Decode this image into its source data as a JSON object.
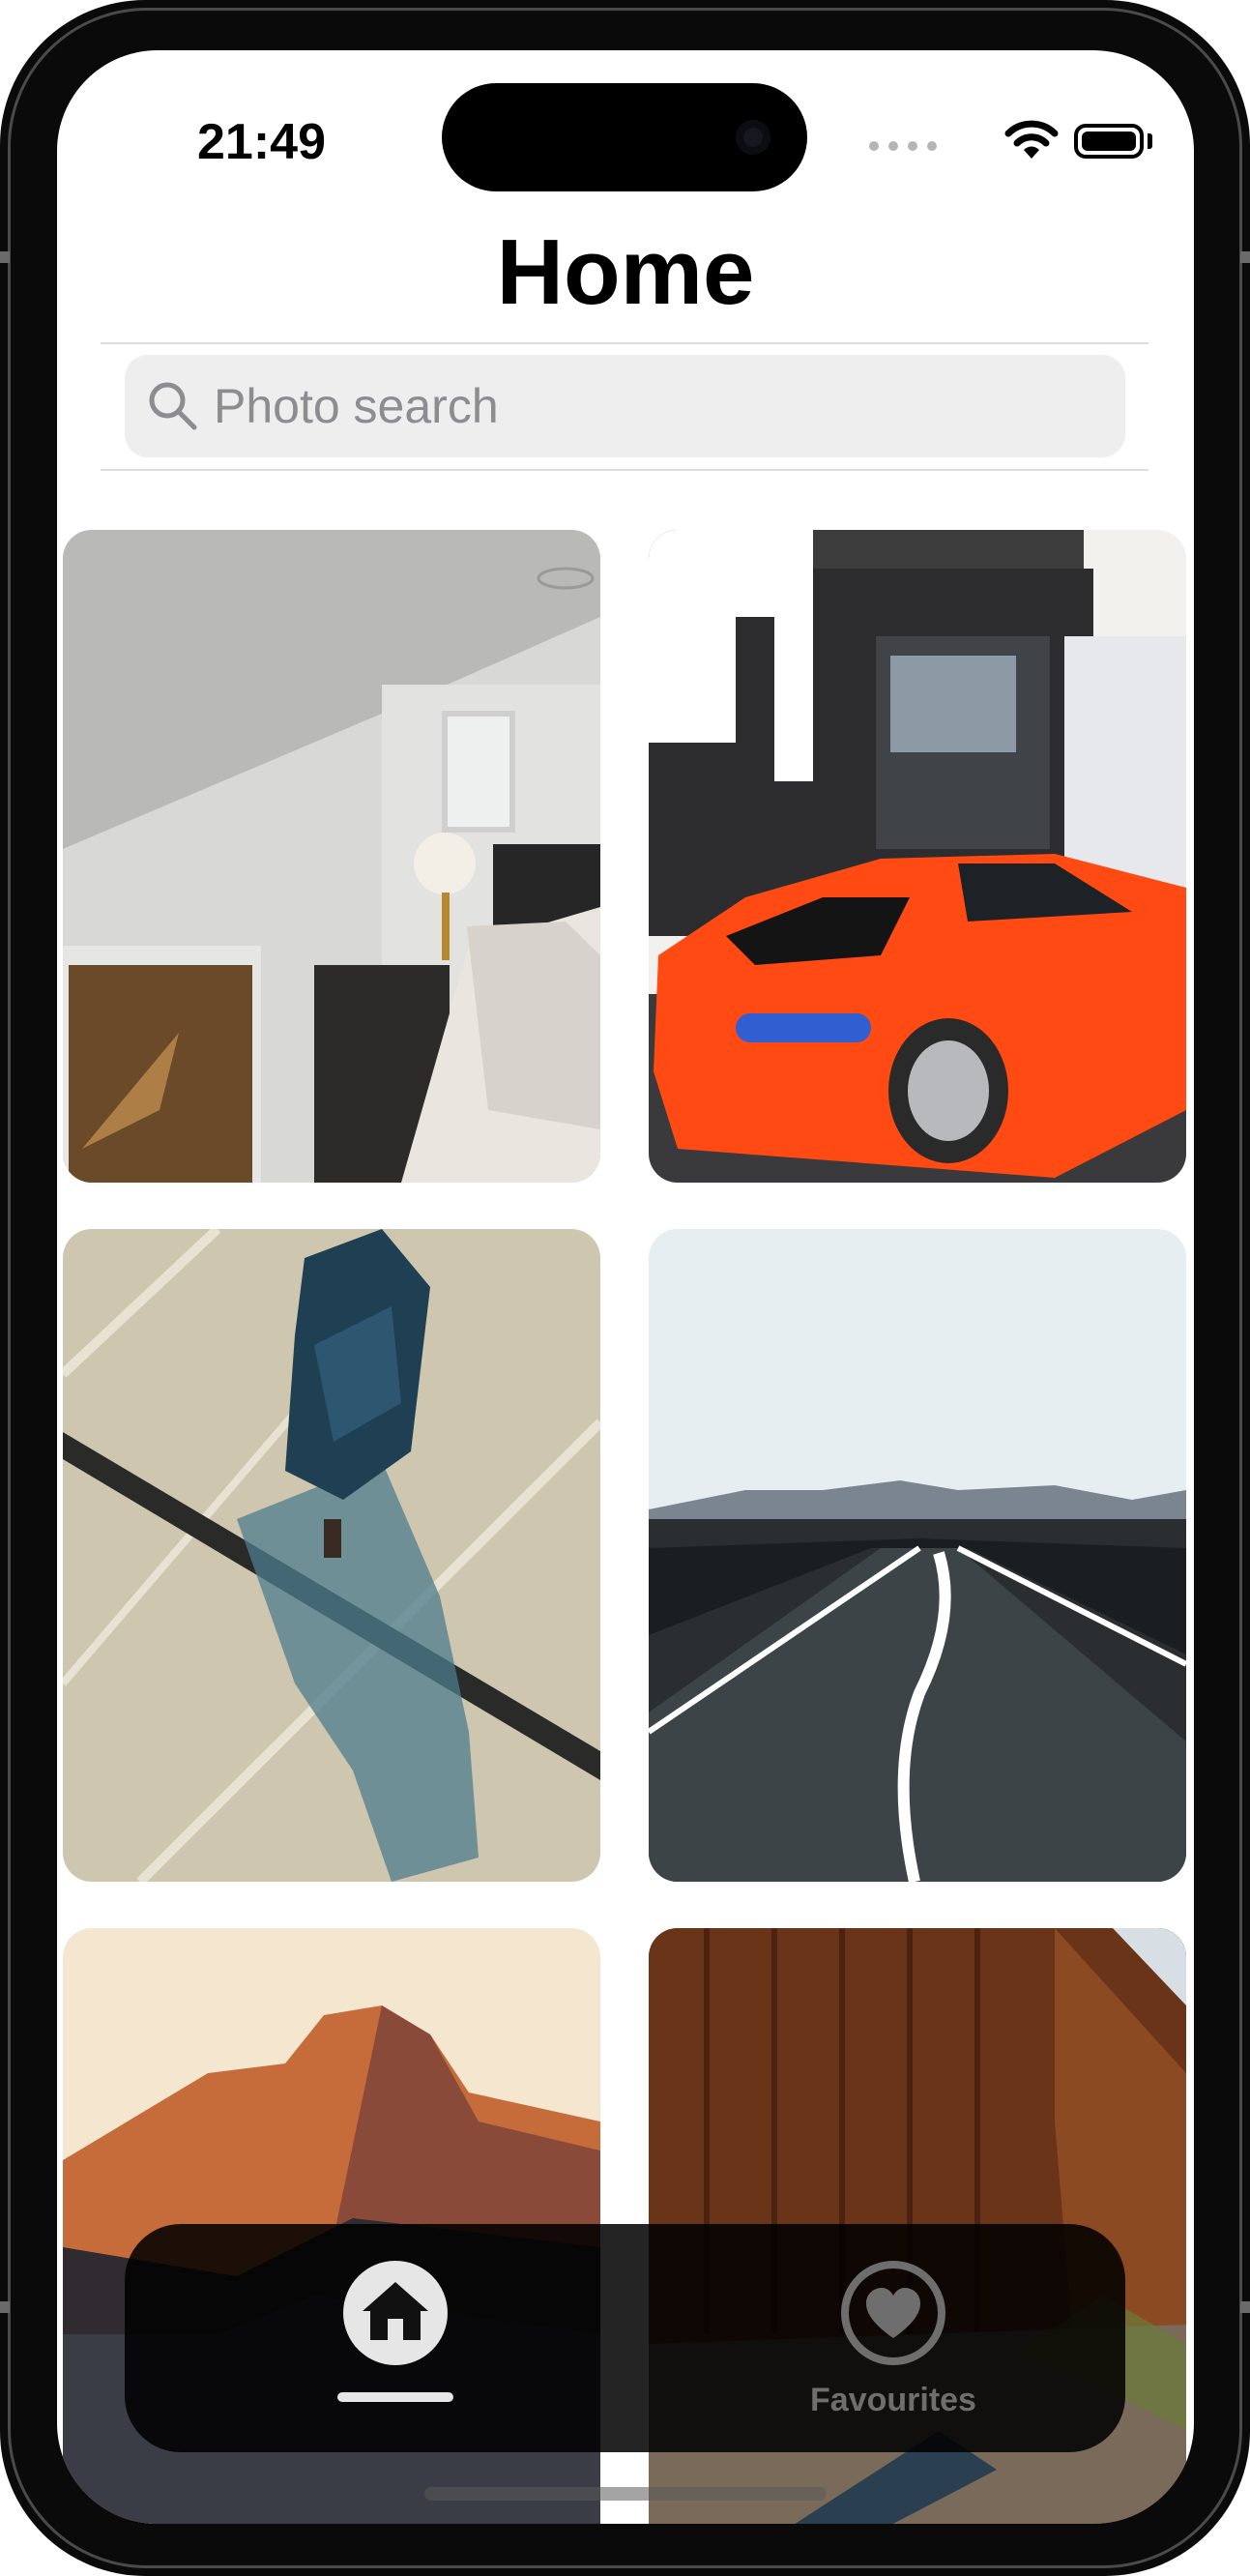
{
  "status_bar": {
    "time": "21:49"
  },
  "header": {
    "title": "Home"
  },
  "search": {
    "placeholder": "Photo search",
    "value": ""
  },
  "photos": [
    {
      "subject": "bedroom"
    },
    {
      "subject": "orange-sports-car"
    },
    {
      "subject": "aerial-parking-car"
    },
    {
      "subject": "desert-road"
    },
    {
      "subject": "mountain-sunset"
    },
    {
      "subject": "wooden-wall"
    }
  ],
  "tab_bar": {
    "tabs": [
      {
        "id": "home",
        "label": "",
        "icon": "house-icon",
        "selected": true
      },
      {
        "id": "favourites",
        "label": "Favourites",
        "icon": "heart-icon",
        "selected": false
      }
    ]
  },
  "colors": {
    "search_bg": "#eeeeef",
    "tab_bar_bg": "#141414",
    "tab_active": "#e6e6e6",
    "tab_inactive": "#6e6e6e"
  }
}
